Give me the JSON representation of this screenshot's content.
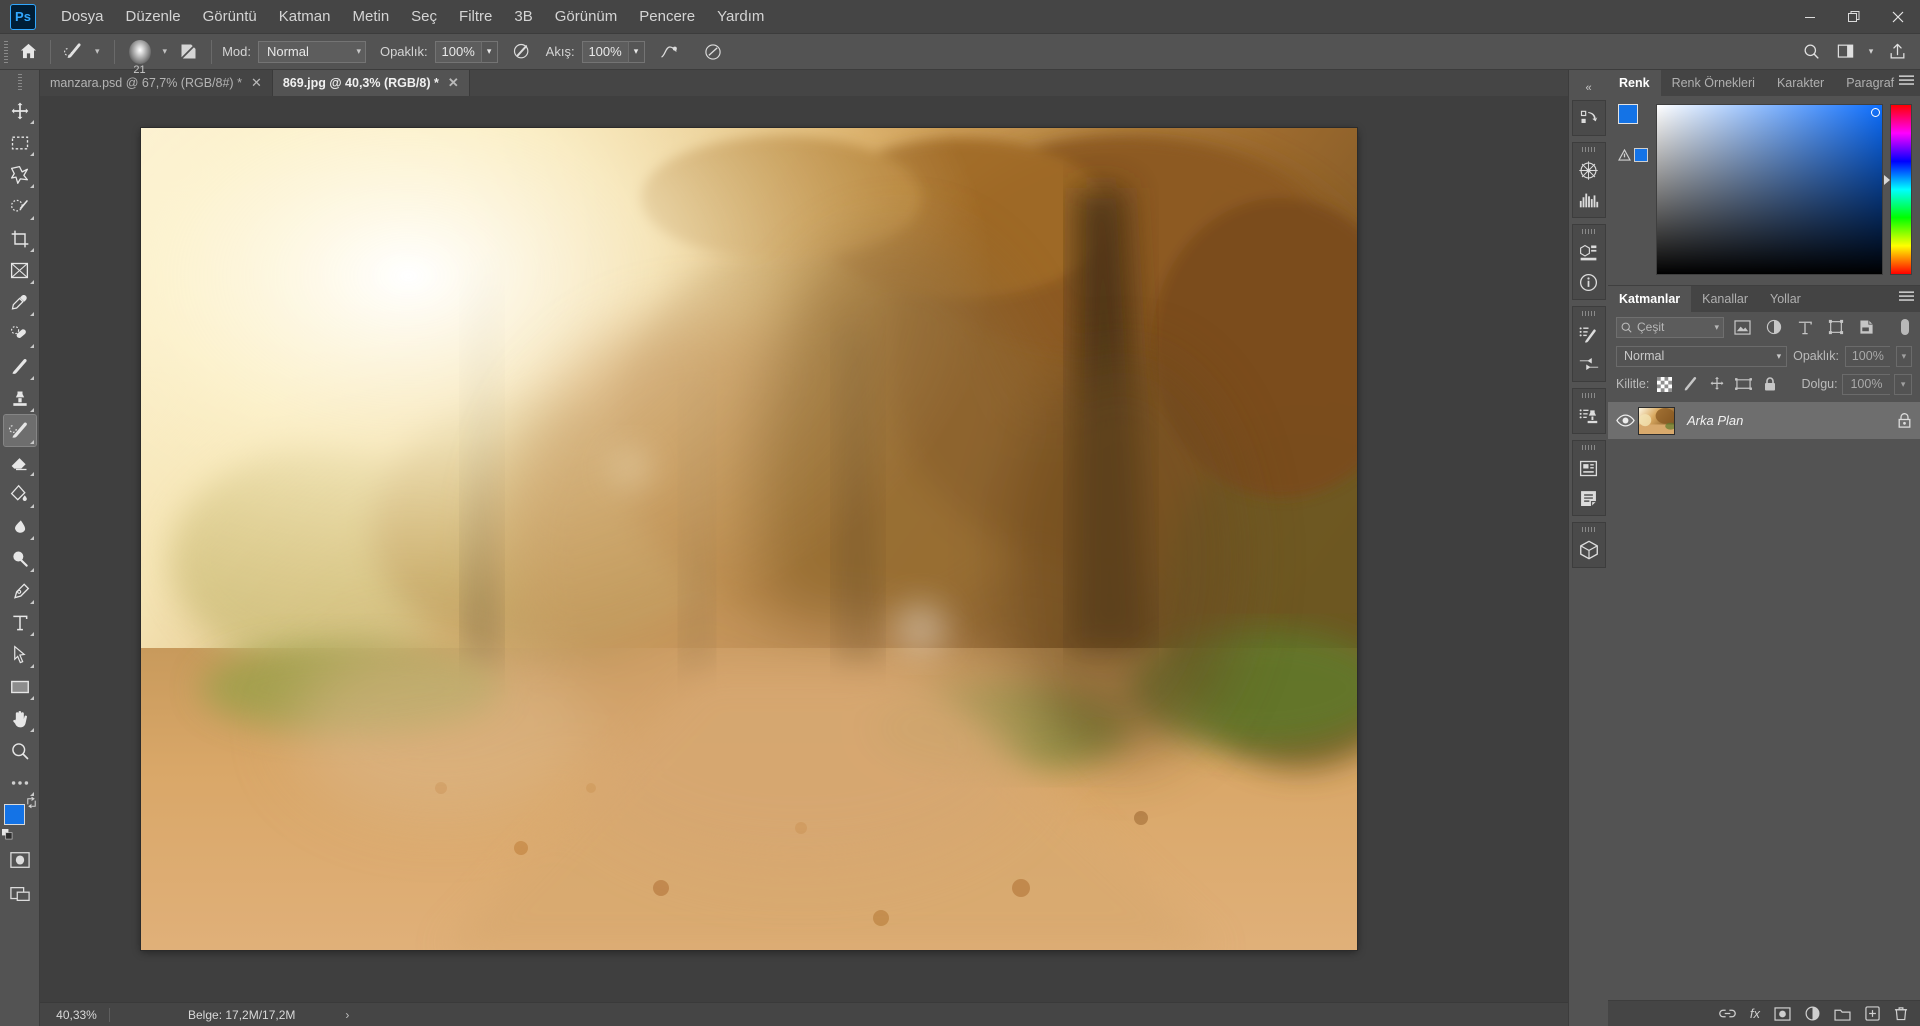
{
  "app": {
    "name": "Adobe Photoshop",
    "logo_text": "Ps",
    "accent_color": "#31a8ff",
    "foreground_color": "#1473e6",
    "background_color": "#ffffff"
  },
  "window_controls": {
    "minimize": "─",
    "maximize": "❐",
    "close": "✕"
  },
  "menu": {
    "items": [
      {
        "label": "Dosya"
      },
      {
        "label": "Düzenle"
      },
      {
        "label": "Görüntü"
      },
      {
        "label": "Katman"
      },
      {
        "label": "Metin"
      },
      {
        "label": "Seç"
      },
      {
        "label": "Filtre"
      },
      {
        "label": "3B"
      },
      {
        "label": "Görünüm"
      },
      {
        "label": "Pencere"
      },
      {
        "label": "Yardım"
      }
    ]
  },
  "options_bar": {
    "home_icon": "home-icon",
    "tool_icon": "history-brush-icon",
    "brush_size": "21",
    "brush_preset_icon": "brush-preset-icon",
    "mode_label": "Mod:",
    "mode_value": "Normal",
    "opacity_label": "Opaklık:",
    "opacity_value": "100%",
    "airbrush_icon": "airbrush-icon",
    "flow_label": "Akış:",
    "flow_value": "100%",
    "smoothing_icon": "smoothing-icon",
    "tablet_pressure_icon": "tablet-pressure-icon",
    "right_icons": [
      {
        "name": "search-icon"
      },
      {
        "name": "workspace-icon"
      },
      {
        "name": "chevron-down-icon"
      },
      {
        "name": "share-icon"
      }
    ]
  },
  "toolbar": {
    "tools": [
      {
        "name": "move-tool",
        "label": "Taşı",
        "active": false
      },
      {
        "name": "marquee-tool",
        "label": "Dikdörtgen Kadraj",
        "active": false
      },
      {
        "name": "lasso-tool",
        "label": "Kement",
        "active": false
      },
      {
        "name": "quick-selection-tool",
        "label": "Hızlı Seçim",
        "active": false
      },
      {
        "name": "crop-tool",
        "label": "Kırp",
        "active": false
      },
      {
        "name": "frame-tool",
        "label": "Çerçeve",
        "active": false
      },
      {
        "name": "eyedropper-tool",
        "label": "Damlalık",
        "active": false
      },
      {
        "name": "healing-brush-tool",
        "label": "Nokta İyileştirme Fırçası",
        "active": false
      },
      {
        "name": "brush-tool",
        "label": "Fırça",
        "active": false
      },
      {
        "name": "clone-stamp-tool",
        "label": "Klon Damgası",
        "active": false
      },
      {
        "name": "history-brush-tool",
        "label": "Geçmiş Fırçası",
        "active": true
      },
      {
        "name": "eraser-tool",
        "label": "Silgi",
        "active": false
      },
      {
        "name": "gradient-tool",
        "label": "Degrade",
        "active": false
      },
      {
        "name": "blur-tool",
        "label": "Bulanıklaştır",
        "active": false
      },
      {
        "name": "dodge-tool",
        "label": "Soldur",
        "active": false
      },
      {
        "name": "pen-tool",
        "label": "Kalem",
        "active": false
      },
      {
        "name": "type-tool",
        "label": "Yatay Metin",
        "active": false
      },
      {
        "name": "path-selection-tool",
        "label": "Yol Seçimi",
        "active": false
      },
      {
        "name": "rectangle-tool",
        "label": "Dikdörtgen",
        "active": false
      },
      {
        "name": "hand-tool",
        "label": "El",
        "active": false
      },
      {
        "name": "zoom-tool",
        "label": "Yakınlaştır",
        "active": false
      },
      {
        "name": "edit-toolbar-tool",
        "label": "•••",
        "active": false
      }
    ],
    "quick_mask_icon": "quick-mask-icon",
    "screen_mode_icon": "screen-mode-icon"
  },
  "document_tabs": [
    {
      "label": "manzara.psd @ 67,7% (RGB/8#) *",
      "active": false,
      "close": "✕"
    },
    {
      "label": "869.jpg @ 40,3% (RGB/8) *",
      "active": true,
      "close": "✕"
    }
  ],
  "status_bar": {
    "zoom": "40,33%",
    "doc_label": "Belge: 17,2M/17,2M",
    "arrow": "›"
  },
  "right_rail": {
    "collapse_icon": "collapse-panels-icon",
    "groups": [
      {
        "icons": [
          {
            "name": "history-icon"
          }
        ]
      },
      {
        "icons": [
          {
            "name": "navigator-icon"
          },
          {
            "name": "histogram-icon"
          }
        ]
      },
      {
        "icons": [
          {
            "name": "3d-icon"
          },
          {
            "name": "info-icon"
          }
        ]
      },
      {
        "icons": [
          {
            "name": "brush-settings-icon"
          },
          {
            "name": "tool-presets-icon"
          }
        ]
      },
      {
        "icons": [
          {
            "name": "clone-source-icon"
          }
        ]
      },
      {
        "icons": [
          {
            "name": "properties-icon"
          },
          {
            "name": "notes-icon"
          }
        ]
      },
      {
        "icons": [
          {
            "name": "materials-icon"
          }
        ]
      }
    ]
  },
  "color_panel": {
    "tabs": [
      {
        "label": "Renk",
        "active": true
      },
      {
        "label": "Renk Örnekleri",
        "active": false
      },
      {
        "label": "Karakter",
        "active": false
      },
      {
        "label": "Paragraf",
        "active": false
      }
    ],
    "menu_icon": "panel-menu-icon",
    "foreground_swatch": "#1473e6",
    "background_swatch": "#ffffff",
    "out_of_gamut_icon": "out-of-gamut-icon",
    "web_safe_icon": "web-safe-icon",
    "ramp_name": "color-field",
    "hue_slider_name": "hue-slider"
  },
  "layers_panel": {
    "tabs": [
      {
        "label": "Katmanlar",
        "active": true
      },
      {
        "label": "Kanallar",
        "active": false
      },
      {
        "label": "Yollar",
        "active": false
      }
    ],
    "menu_icon": "panel-menu-icon",
    "filter": {
      "search_icon": "search-icon",
      "kind_label": "Çeşit",
      "chevron": "⌄",
      "icons": [
        {
          "name": "filter-pixel-icon"
        },
        {
          "name": "filter-adjustment-icon"
        },
        {
          "name": "filter-type-icon"
        },
        {
          "name": "filter-shape-icon"
        },
        {
          "name": "filter-smart-object-icon"
        }
      ],
      "toggle_name": "filter-toggle"
    },
    "blend_mode": "Normal",
    "opacity_label": "Opaklık:",
    "opacity_value": "100%",
    "lock_label": "Kilitle:",
    "lock_icons": [
      {
        "name": "lock-transparent-pixels-icon"
      },
      {
        "name": "lock-image-pixels-icon"
      },
      {
        "name": "lock-position-icon"
      },
      {
        "name": "lock-artboard-icon"
      },
      {
        "name": "lock-all-icon"
      }
    ],
    "fill_label": "Dolgu:",
    "fill_value": "100%",
    "layers": [
      {
        "name": "Arka Plan",
        "visible": true,
        "locked": true,
        "selected": true,
        "eye_icon": "eye-icon",
        "lock_icon": "lock-icon"
      }
    ],
    "footer_icons": [
      {
        "name": "link-layers-icon"
      },
      {
        "name": "layer-style-icon",
        "glyph": "fx"
      },
      {
        "name": "layer-mask-icon"
      },
      {
        "name": "adjustment-layer-icon"
      },
      {
        "name": "new-group-icon"
      },
      {
        "name": "new-layer-icon"
      },
      {
        "name": "delete-layer-icon"
      }
    ]
  },
  "canvas": {
    "document_name": "869.jpg",
    "alt": "Autumn forest path with fallen leaves, sun flare through trees, partially blurred with history brush strokes"
  }
}
